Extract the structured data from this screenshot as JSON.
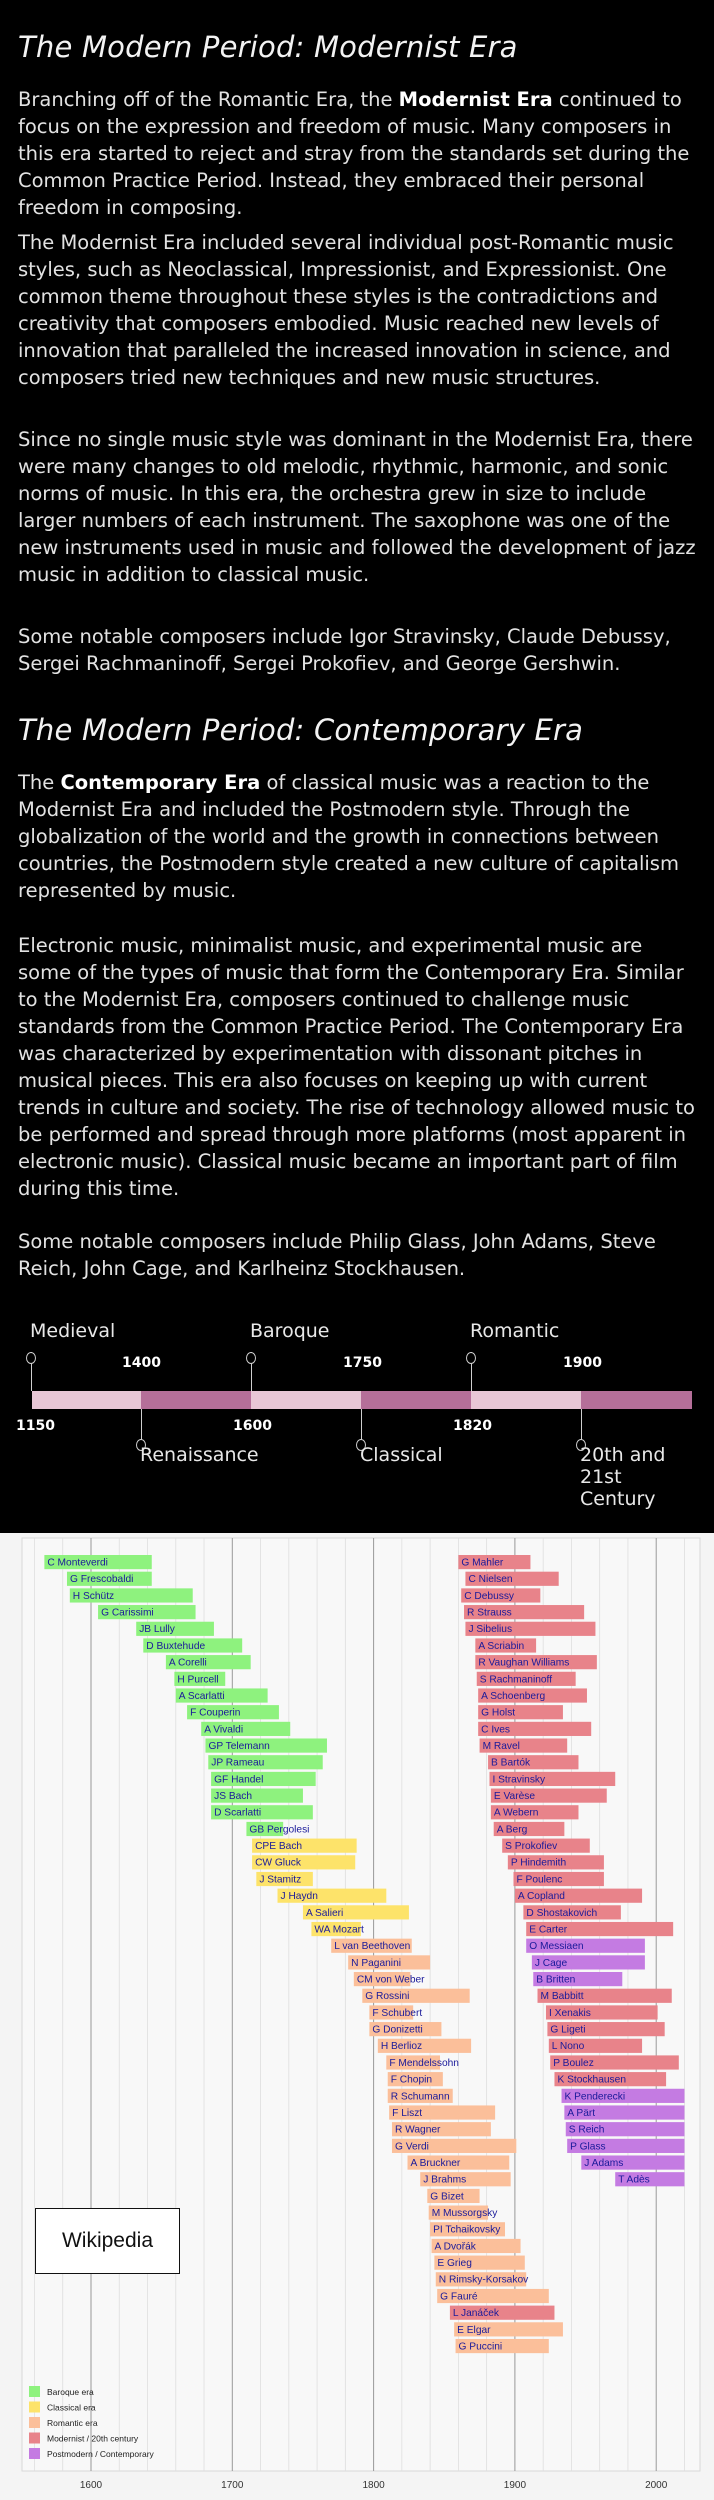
{
  "modernist": {
    "title": "The Modern Period: Modernist Era",
    "p1_pre": "Branching off of the Romantic Era, the ",
    "p1_bold": "Modernist Era",
    "p1_post": " continued to focus on the expression and freedom of music. Many composers in this era started to reject and stray from the standards set during the Common Practice Period. Instead, they embraced their personal freedom in composing.",
    "p2": "The Modernist Era included several individual post-Romantic music styles, such as Neoclassical, Impressionist, and Expressionist. One common theme throughout these styles is the contradictions and creativity that composers embodied. Music reached new levels of innovation that paralleled the increased innovation in science, and composers tried new techniques and new music structures.",
    "p3": "Since no single music style was dominant in the Modernist Era, there were many changes to old melodic, rhythmic, harmonic, and sonic norms of music. In this era, the orchestra grew in size to include larger numbers of each instrument. The saxophone was one of the new instruments used in music and followed the development of jazz music in addition to classical music.",
    "p4": "Some notable composers include Igor Stravinsky, Claude Debussy, Sergei Rachmaninoff, Sergei Prokofiev, and George Gershwin."
  },
  "contemporary": {
    "title": "The Modern Period: Contemporary Era",
    "p1_pre": "The ",
    "p1_bold": "Contemporary Era",
    "p1_post": " of classical music was a reaction to the Modernist Era and included the Postmodern style. Through the globalization of the world and the growth in connections between countries, the Postmodern style created a new culture of capitalism represented by music.",
    "p2": "Electronic music, minimalist music, and experimental music are some of the types of music that form the Contemporary Era. Similar to the Modernist Era, composers continued to challenge music standards from the Common Practice Period. The Contemporary Era was characterized by experimentation with dissonant pitches in musical pieces. This era also focuses on keeping up with current trends in culture and society. The rise of technology allowed music to be performed and spread through more platforms (most apparent in electronic music). Classical music became an important part of film during this time.",
    "p3": "Some notable composers include Philip Glass, John Adams, Steve Reich, John Cage, and Karlheinz Stockhausen."
  },
  "timeline": {
    "colors": {
      "light": "#e8c7d6",
      "dark": "#b56f99"
    },
    "segments": [
      {
        "era": "Medieval",
        "start": "1150",
        "end": "1400",
        "shade": "light",
        "label_side": "top"
      },
      {
        "era": "Renaissance",
        "start": "1400",
        "end": "1600",
        "shade": "dark",
        "label_side": "bottom"
      },
      {
        "era": "Baroque",
        "start": "1600",
        "end": "1750",
        "shade": "light",
        "label_side": "top"
      },
      {
        "era": "Classical",
        "start": "1750",
        "end": "1820",
        "shade": "dark",
        "label_side": "bottom"
      },
      {
        "era": "Romantic",
        "start": "1820",
        "end": "1900",
        "shade": "light",
        "label_side": "top"
      },
      {
        "era": "20th and 21st Century",
        "start": "1900",
        "end": "",
        "shade": "dark",
        "label_side": "bottom"
      }
    ],
    "years_top": [
      "1400",
      "1750",
      "1900"
    ],
    "years_bottom": [
      "1150",
      "1600",
      "1820"
    ]
  },
  "chart_data": {
    "type": "bar",
    "subtype": "gantt-timeline",
    "title": "",
    "xlabel": "",
    "ylabel": "",
    "xlim": [
      1545,
      2020
    ],
    "xticks": [
      1600,
      1700,
      1800,
      1900,
      2000
    ],
    "grid": true,
    "watermark": "Wikipedia",
    "legend": [
      {
        "name": "Baroque era",
        "color": "#8ef27e"
      },
      {
        "name": "Classical era",
        "color": "#fde36a"
      },
      {
        "name": "Romantic era",
        "color": "#fbbf9a"
      },
      {
        "name": "Modernist / 20th century",
        "color": "#e8838a"
      },
      {
        "name": "Postmodern / Contemporary",
        "color": "#c47be2"
      }
    ],
    "legend_placement": "bottom-left",
    "columns": [
      {
        "column": "left",
        "composers": [
          {
            "name": "C Monteverdi",
            "start": 1567,
            "end": 1643,
            "era": "baroque"
          },
          {
            "name": "G Frescobaldi",
            "start": 1583,
            "end": 1643,
            "era": "baroque"
          },
          {
            "name": "H Schütz",
            "start": 1585,
            "end": 1672,
            "era": "baroque"
          },
          {
            "name": "G Carissimi",
            "start": 1605,
            "end": 1674,
            "era": "baroque"
          },
          {
            "name": "JB Lully",
            "start": 1632,
            "end": 1687,
            "era": "baroque"
          },
          {
            "name": "D Buxtehude",
            "start": 1637,
            "end": 1707,
            "era": "baroque"
          },
          {
            "name": "A Corelli",
            "start": 1653,
            "end": 1713,
            "era": "baroque"
          },
          {
            "name": "H Purcell",
            "start": 1659,
            "end": 1695,
            "era": "baroque"
          },
          {
            "name": "A Scarlatti",
            "start": 1660,
            "end": 1725,
            "era": "baroque"
          },
          {
            "name": "F Couperin",
            "start": 1668,
            "end": 1733,
            "era": "baroque"
          },
          {
            "name": "A Vivaldi",
            "start": 1678,
            "end": 1741,
            "era": "baroque"
          },
          {
            "name": "GP Telemann",
            "start": 1681,
            "end": 1767,
            "era": "baroque"
          },
          {
            "name": "JP Rameau",
            "start": 1683,
            "end": 1764,
            "era": "baroque"
          },
          {
            "name": "GF Handel",
            "start": 1685,
            "end": 1759,
            "era": "baroque"
          },
          {
            "name": "JS Bach",
            "start": 1685,
            "end": 1750,
            "era": "baroque"
          },
          {
            "name": "D Scarlatti",
            "start": 1685,
            "end": 1757,
            "era": "baroque"
          },
          {
            "name": "GB Pergolesi",
            "start": 1710,
            "end": 1736,
            "era": "baroque"
          },
          {
            "name": "CPE Bach",
            "start": 1714,
            "end": 1788,
            "era": "classical"
          },
          {
            "name": "CW Gluck",
            "start": 1714,
            "end": 1787,
            "era": "classical"
          },
          {
            "name": "J Stamitz",
            "start": 1717,
            "end": 1757,
            "era": "classical"
          },
          {
            "name": "J Haydn",
            "start": 1732,
            "end": 1809,
            "era": "classical"
          },
          {
            "name": "A Salieri",
            "start": 1750,
            "end": 1825,
            "era": "classical"
          },
          {
            "name": "WA Mozart",
            "start": 1756,
            "end": 1791,
            "era": "classical"
          },
          {
            "name": "L van Beethoven",
            "start": 1770,
            "end": 1827,
            "era": "romantic"
          },
          {
            "name": "N Paganini",
            "start": 1782,
            "end": 1840,
            "era": "romantic"
          },
          {
            "name": "CM von Weber",
            "start": 1786,
            "end": 1826,
            "era": "romantic"
          },
          {
            "name": "G Rossini",
            "start": 1792,
            "end": 1868,
            "era": "romantic"
          },
          {
            "name": "F Schubert",
            "start": 1797,
            "end": 1828,
            "era": "romantic"
          },
          {
            "name": "G Donizetti",
            "start": 1797,
            "end": 1848,
            "era": "romantic"
          },
          {
            "name": "H Berlioz",
            "start": 1803,
            "end": 1869,
            "era": "romantic"
          },
          {
            "name": "F Mendelssohn",
            "start": 1809,
            "end": 1847,
            "era": "romantic"
          },
          {
            "name": "F Chopin",
            "start": 1810,
            "end": 1849,
            "era": "romantic"
          },
          {
            "name": "R Schumann",
            "start": 1810,
            "end": 1856,
            "era": "romantic"
          },
          {
            "name": "F Liszt",
            "start": 1811,
            "end": 1886,
            "era": "romantic"
          },
          {
            "name": "R Wagner",
            "start": 1813,
            "end": 1883,
            "era": "romantic"
          },
          {
            "name": "G Verdi",
            "start": 1813,
            "end": 1901,
            "era": "romantic"
          },
          {
            "name": "A Bruckner",
            "start": 1824,
            "end": 1896,
            "era": "romantic"
          },
          {
            "name": "J Brahms",
            "start": 1833,
            "end": 1897,
            "era": "romantic"
          },
          {
            "name": "G Bizet",
            "start": 1838,
            "end": 1875,
            "era": "romantic"
          },
          {
            "name": "M Mussorgsky",
            "start": 1839,
            "end": 1881,
            "era": "romantic"
          },
          {
            "name": "PI Tchaikovsky",
            "start": 1840,
            "end": 1893,
            "era": "romantic"
          },
          {
            "name": "A Dvořák",
            "start": 1841,
            "end": 1904,
            "era": "romantic"
          },
          {
            "name": "E Grieg",
            "start": 1843,
            "end": 1907,
            "era": "romantic"
          },
          {
            "name": "N Rimsky-Korsakov",
            "start": 1844,
            "end": 1908,
            "era": "romantic"
          },
          {
            "name": "G Fauré",
            "start": 1845,
            "end": 1924,
            "era": "romantic"
          },
          {
            "name": "L Janáček",
            "start": 1854,
            "end": 1928,
            "era": "modernist"
          },
          {
            "name": "E Elgar",
            "start": 1857,
            "end": 1934,
            "era": "romantic"
          },
          {
            "name": "G Puccini",
            "start": 1858,
            "end": 1924,
            "era": "romantic"
          }
        ]
      },
      {
        "column": "right",
        "composers": [
          {
            "name": "G Mahler",
            "start": 1860,
            "end": 1911,
            "era": "modernist"
          },
          {
            "name": "C Nielsen",
            "start": 1865,
            "end": 1931,
            "era": "modernist"
          },
          {
            "name": "C Debussy",
            "start": 1862,
            "end": 1918,
            "era": "modernist"
          },
          {
            "name": "R Strauss",
            "start": 1864,
            "end": 1949,
            "era": "modernist"
          },
          {
            "name": "J Sibelius",
            "start": 1865,
            "end": 1957,
            "era": "modernist"
          },
          {
            "name": "A Scriabin",
            "start": 1872,
            "end": 1915,
            "era": "modernist"
          },
          {
            "name": "R Vaughan Williams",
            "start": 1872,
            "end": 1958,
            "era": "modernist"
          },
          {
            "name": "S Rachmaninoff",
            "start": 1873,
            "end": 1943,
            "era": "modernist"
          },
          {
            "name": "A Schoenberg",
            "start": 1874,
            "end": 1951,
            "era": "modernist"
          },
          {
            "name": "G Holst",
            "start": 1874,
            "end": 1934,
            "era": "modernist"
          },
          {
            "name": "C Ives",
            "start": 1874,
            "end": 1954,
            "era": "modernist"
          },
          {
            "name": "M Ravel",
            "start": 1875,
            "end": 1937,
            "era": "modernist"
          },
          {
            "name": "B Bartók",
            "start": 1881,
            "end": 1945,
            "era": "modernist"
          },
          {
            "name": "I Stravinsky",
            "start": 1882,
            "end": 1971,
            "era": "modernist"
          },
          {
            "name": "E Varèse",
            "start": 1883,
            "end": 1965,
            "era": "modernist"
          },
          {
            "name": "A Webern",
            "start": 1883,
            "end": 1945,
            "era": "modernist"
          },
          {
            "name": "A Berg",
            "start": 1885,
            "end": 1935,
            "era": "modernist"
          },
          {
            "name": "S Prokofiev",
            "start": 1891,
            "end": 1953,
            "era": "modernist"
          },
          {
            "name": "P Hindemith",
            "start": 1895,
            "end": 1963,
            "era": "modernist"
          },
          {
            "name": "F Poulenc",
            "start": 1899,
            "end": 1963,
            "era": "modernist"
          },
          {
            "name": "A Copland",
            "start": 1900,
            "end": 1990,
            "era": "modernist"
          },
          {
            "name": "D Shostakovich",
            "start": 1906,
            "end": 1975,
            "era": "modernist"
          },
          {
            "name": "E Carter",
            "start": 1908,
            "end": 2012,
            "era": "modernist"
          },
          {
            "name": "O Messiaen",
            "start": 1908,
            "end": 1992,
            "era": "postmodern"
          },
          {
            "name": "J Cage",
            "start": 1912,
            "end": 1992,
            "era": "postmodern"
          },
          {
            "name": "B Britten",
            "start": 1913,
            "end": 1976,
            "era": "postmodern"
          },
          {
            "name": "M Babbitt",
            "start": 1916,
            "end": 2011,
            "era": "modernist"
          },
          {
            "name": "I Xenakis",
            "start": 1922,
            "end": 2001,
            "era": "modernist"
          },
          {
            "name": "G Ligeti",
            "start": 1923,
            "end": 2006,
            "era": "modernist"
          },
          {
            "name": "L Nono",
            "start": 1924,
            "end": 1990,
            "era": "modernist"
          },
          {
            "name": "P Boulez",
            "start": 1925,
            "end": 2016,
            "era": "modernist"
          },
          {
            "name": "K Stockhausen",
            "start": 1928,
            "end": 2007,
            "era": "modernist"
          },
          {
            "name": "K Penderecki",
            "start": 1933,
            "end": 2020,
            "era": "postmodern"
          },
          {
            "name": "A Pärt",
            "start": 1935,
            "end": 2020,
            "era": "postmodern"
          },
          {
            "name": "S Reich",
            "start": 1936,
            "end": 2020,
            "era": "postmodern"
          },
          {
            "name": "P Glass",
            "start": 1937,
            "end": 2020,
            "era": "postmodern"
          },
          {
            "name": "J Adams",
            "start": 1947,
            "end": 2020,
            "era": "postmodern"
          },
          {
            "name": "T Adès",
            "start": 1971,
            "end": 2020,
            "era": "postmodern"
          }
        ]
      }
    ]
  }
}
